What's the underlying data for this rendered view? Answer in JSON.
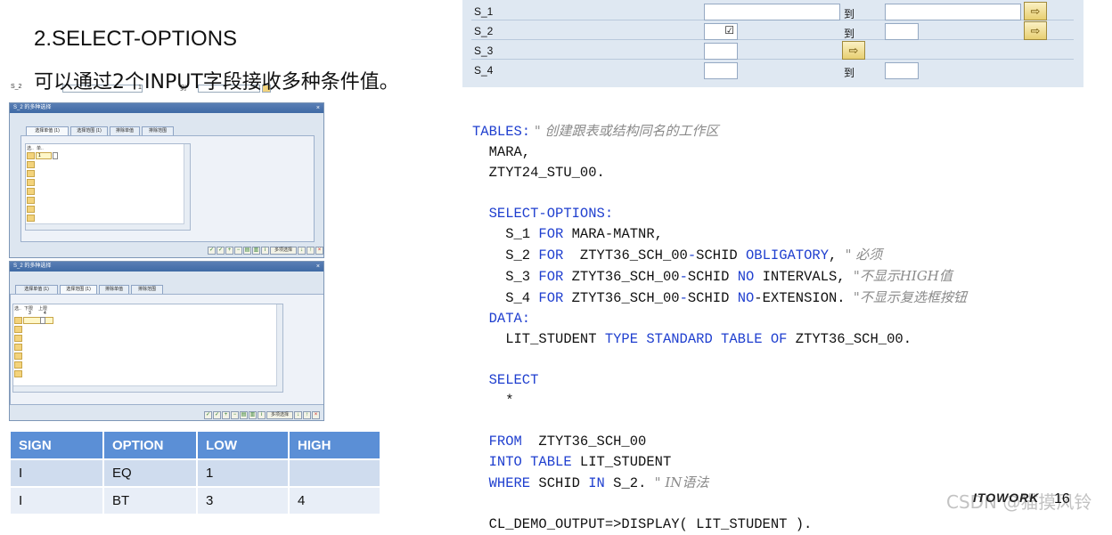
{
  "heading": {
    "title": "2.SELECT-OPTIONS",
    "subtitle": "可以通过2个INPUT字段接收多种条件值。"
  },
  "mini_strip": {
    "label": "S_2",
    "field1": "1",
    "to": "到"
  },
  "dialog1": {
    "title": "S_2 的多种选择",
    "tabs": [
      "选择单值 (1)",
      "选择范围 (1)",
      "排除单值",
      "排除范围"
    ],
    "col_headers": [
      "选..",
      "单.."
    ],
    "row_value": "1"
  },
  "dialog2": {
    "title": "S_2 的多种选择",
    "tabs": [
      "选择单值 (1)",
      "选择范围 (1)",
      "排除单值",
      "排除范围"
    ],
    "col_headers": [
      "选..",
      "下限",
      "上限"
    ],
    "row_values": [
      "3",
      "4"
    ]
  },
  "toolbar_wide_label": "多项选择",
  "options_table": {
    "headers": [
      "SIGN",
      "OPTION",
      "LOW",
      "HIGH"
    ],
    "rows": [
      [
        "I",
        "EQ",
        "1",
        ""
      ],
      [
        "I",
        "BT",
        "3",
        "4"
      ]
    ]
  },
  "selection_screen": {
    "rows": [
      {
        "label": "S_1",
        "to": "到"
      },
      {
        "label": "S_2",
        "to": "到",
        "checkbox": "☑"
      },
      {
        "label": "S_3"
      },
      {
        "label": "S_4",
        "to": "到"
      }
    ]
  },
  "code": {
    "l1_kw": "TABLES:",
    "l1_cm": " \" 创建跟表或结构同名的工作区",
    "l2": "  MARA,",
    "l3": "  ZTYT24_STU_00.",
    "l5_kw": "  SELECT-OPTIONS:",
    "l6_a": "    S_1 ",
    "l6_kw": "FOR",
    "l6_b": " MARA-MATNR,",
    "l7_a": "    S_2 ",
    "l7_kw": "FOR",
    "l7_b": "  ZTYT36_SCH_00",
    "l7_kw2": "-",
    "l7_c": "SCHID ",
    "l7_kw3": "OBLIGATORY",
    "l7_d": ", ",
    "l7_cm": "\" 必须",
    "l8_a": "    S_3 ",
    "l8_kw": "FOR",
    "l8_b": " ZTYT36_SCH_00",
    "l8_kw2": "-",
    "l8_c": "SCHID ",
    "l8_kw3": "NO",
    "l8_d": " INTERVALS, ",
    "l8_cm": "\"不显示HIGH值",
    "l9_a": "    S_4 ",
    "l9_kw": "FOR",
    "l9_b": " ZTYT36_SCH_00",
    "l9_kw2": "-",
    "l9_c": "SCHID ",
    "l9_kw3": "NO",
    "l9_d": "-EXTENSION. ",
    "l9_cm": "\"不显示复选框按钮",
    "l10_kw": "  DATA:",
    "l11_a": "    LIT_STUDENT ",
    "l11_kw": "TYPE STANDARD TABLE OF",
    "l11_b": " ZTYT36_SCH_00.",
    "l13_kw": "  SELECT",
    "l14": "    *",
    "l15_kw": "  FROM",
    "l15_b": "  ZTYT36_SCH_00",
    "l16_kw": "  INTO TABLE",
    "l16_b": " LIT_STUDENT",
    "l17_kw": "  WHERE",
    "l17_b": " SCHID ",
    "l17_kw2": "IN",
    "l17_c": " S_2. ",
    "l17_cm": "\" IN语法",
    "l19_a": "  CL_DEMO_OUTPUT=>DISPLAY( LIT_STUDENT ).",
    "footer_logo": "ITOWORK",
    "page": "16",
    "watermark": "CSDN @猫摸风铃"
  }
}
